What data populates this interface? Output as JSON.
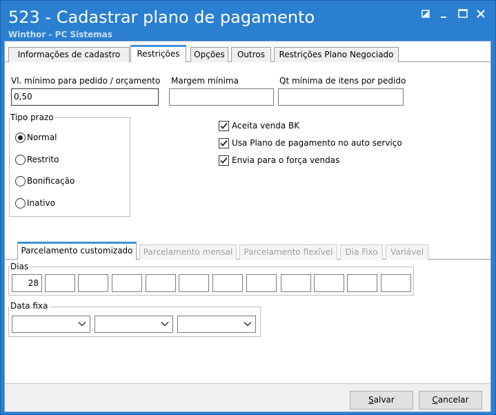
{
  "window": {
    "title": "523 - Cadastrar plano de pagamento",
    "subtitle": "Winthor - PC Sistemas"
  },
  "tabs": [
    "Informações de cadastro",
    "Restrições",
    "Opções",
    "Outros",
    "Restrições Plano Negociado"
  ],
  "active_tab": "Restrições",
  "fields": {
    "vl_minimo": {
      "label": "Vl. mínimo para pedido / orçamento",
      "value": "0,50"
    },
    "margem_minima": {
      "label": "Margem mínima",
      "value": ""
    },
    "qt_minima": {
      "label": "Qt mínima de itens por pedido",
      "value": ""
    }
  },
  "tipo_prazo": {
    "label": "Tipo prazo",
    "options": [
      "Normal",
      "Restrito",
      "Bonificação",
      "Inativo"
    ],
    "selected": "Normal"
  },
  "checkboxes": [
    {
      "label": "Aceita venda BK",
      "checked": true
    },
    {
      "label": "Usa Plano de pagamento no auto serviço",
      "checked": true
    },
    {
      "label": "Envia para o força vendas",
      "checked": true
    }
  ],
  "sub_tabs": [
    "Parcelamento customizado",
    "Parcelamento mensal",
    "Parcelamento flexível",
    "Dia Fixo",
    "Variável"
  ],
  "active_sub_tab": "Parcelamento customizado",
  "dias": {
    "label": "Dias",
    "values": [
      "28",
      "",
      "",
      "",
      "",
      "",
      "",
      "",
      "",
      "",
      "",
      ""
    ]
  },
  "data_fixa": {
    "label": "Data fixa",
    "values": [
      "",
      "",
      ""
    ]
  },
  "buttons": {
    "salvar_first": "S",
    "salvar_rest": "alvar",
    "cancelar_first": "C",
    "cancelar_rest": "ancelar"
  }
}
